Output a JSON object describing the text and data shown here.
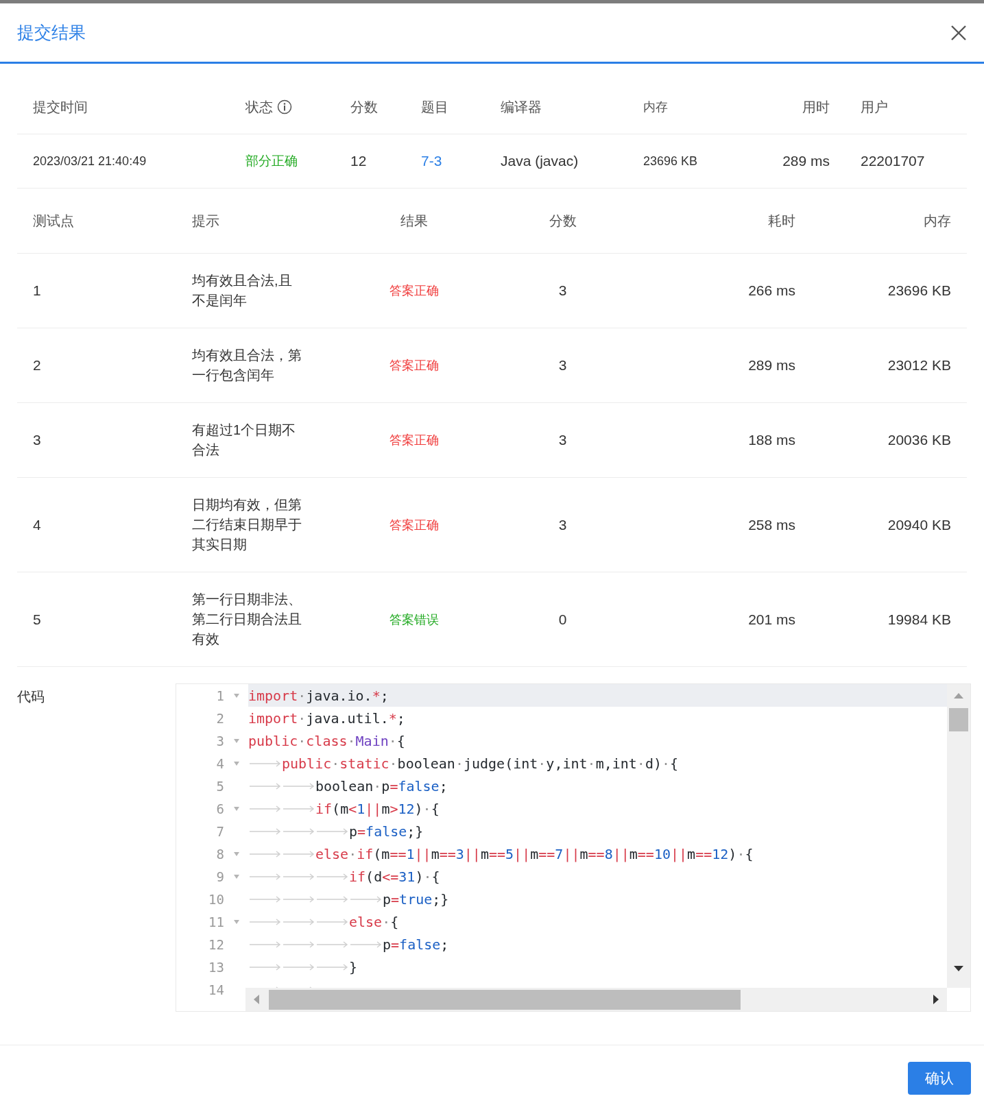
{
  "dialog": {
    "title": "提交结果"
  },
  "submission": {
    "columns": [
      "提交时间",
      "状态",
      "分数",
      "题目",
      "编译器",
      "内存",
      "用时",
      "用户"
    ],
    "row": {
      "time": "2023/03/21 21:40:49",
      "status": {
        "text": "部分正确",
        "color": "#22aa22"
      },
      "score": "12",
      "problem": "7-3",
      "compiler": "Java (javac)",
      "memory": "23696 KB",
      "duration": "289 ms",
      "user": "22201707"
    }
  },
  "results": {
    "columns": [
      "测试点",
      "提示",
      "结果",
      "分数",
      "耗时",
      "内存"
    ],
    "rows": [
      {
        "case": "1",
        "hint": "均有效且合法,且不是闰年",
        "result": "答案正确",
        "color": "#f03c3c",
        "score": "3",
        "time": "266 ms",
        "memory": "23696 KB"
      },
      {
        "case": "2",
        "hint": "均有效且合法，第一行包含闰年",
        "result": "答案正确",
        "color": "#f03c3c",
        "score": "3",
        "time": "289 ms",
        "memory": "23012 KB"
      },
      {
        "case": "3",
        "hint": "有超过1个日期不合法",
        "result": "答案正确",
        "color": "#f03c3c",
        "score": "3",
        "time": "188 ms",
        "memory": "20036 KB"
      },
      {
        "case": "4",
        "hint": "日期均有效，但第二行结束日期早于其实日期",
        "result": "答案正确",
        "color": "#f03c3c",
        "score": "3",
        "time": "258 ms",
        "memory": "20940 KB"
      },
      {
        "case": "5",
        "hint": "第一行日期非法、第二行日期合法且有效",
        "result": "答案错误",
        "color": "#22aa22",
        "score": "0",
        "time": "201 ms",
        "memory": "19984 KB"
      }
    ]
  },
  "code": {
    "label": "代码",
    "lines": [
      {
        "number": "1",
        "fold": true,
        "active": true,
        "tokens": [
          {
            "kind": "kw",
            "t": "import"
          },
          {
            "kind": "ws",
            "t": "·"
          },
          {
            "kind": "pl",
            "t": "java.io."
          },
          {
            "kind": "op",
            "t": "*"
          },
          {
            "kind": "pl",
            "t": ";"
          }
        ]
      },
      {
        "number": "2",
        "fold": false,
        "active": false,
        "tokens": [
          {
            "kind": "kw",
            "t": "import"
          },
          {
            "kind": "ws",
            "t": "·"
          },
          {
            "kind": "pl",
            "t": "java.util."
          },
          {
            "kind": "op",
            "t": "*"
          },
          {
            "kind": "pl",
            "t": ";"
          }
        ]
      },
      {
        "number": "3",
        "fold": true,
        "active": false,
        "tokens": [
          {
            "kind": "kw",
            "t": "public"
          },
          {
            "kind": "ws",
            "t": "·"
          },
          {
            "kind": "kw",
            "t": "class"
          },
          {
            "kind": "ws",
            "t": "·"
          },
          {
            "kind": "ty",
            "t": "Main"
          },
          {
            "kind": "ws",
            "t": "·"
          },
          {
            "kind": "pl",
            "t": "{"
          }
        ],
        "children": [
          {
            "number": "4",
            "fold": true,
            "active": false,
            "tokens": [
              {
                "kind": "kw",
                "t": "public"
              },
              {
                "kind": "ws",
                "t": "·"
              },
              {
                "kind": "kw",
                "t": "static"
              },
              {
                "kind": "ws",
                "t": "·"
              },
              {
                "kind": "pl",
                "t": "boolean"
              },
              {
                "kind": "ws",
                "t": "·"
              },
              {
                "kind": "pl",
                "t": "judge(int"
              },
              {
                "kind": "ws",
                "t": "·"
              },
              {
                "kind": "pl",
                "t": "y,int"
              },
              {
                "kind": "ws",
                "t": "·"
              },
              {
                "kind": "pl",
                "t": "m,int"
              },
              {
                "kind": "ws",
                "t": "·"
              },
              {
                "kind": "pl",
                "t": "d)"
              },
              {
                "kind": "ws",
                "t": "·"
              },
              {
                "kind": "pl",
                "t": "{"
              }
            ],
            "children": [
              {
                "number": "5",
                "fold": false,
                "active": false,
                "tokens": [
                  {
                    "kind": "pl",
                    "t": "boolean"
                  },
                  {
                    "kind": "ws",
                    "t": "·"
                  },
                  {
                    "kind": "pl",
                    "t": "p"
                  },
                  {
                    "kind": "op",
                    "t": "="
                  },
                  {
                    "kind": "nu",
                    "t": "false"
                  },
                  {
                    "kind": "pl",
                    "t": ";"
                  }
                ]
              },
              {
                "number": "6",
                "fold": true,
                "active": false,
                "tokens": [
                  {
                    "kind": "kw",
                    "t": "if"
                  },
                  {
                    "kind": "pl",
                    "t": "(m"
                  },
                  {
                    "kind": "op",
                    "t": "<"
                  },
                  {
                    "kind": "nu",
                    "t": "1"
                  },
                  {
                    "kind": "op",
                    "t": "||"
                  },
                  {
                    "kind": "pl",
                    "t": "m"
                  },
                  {
                    "kind": "op",
                    "t": ">"
                  },
                  {
                    "kind": "nu",
                    "t": "12"
                  },
                  {
                    "kind": "pl",
                    "t": ")"
                  },
                  {
                    "kind": "ws",
                    "t": "·"
                  },
                  {
                    "kind": "pl",
                    "t": "{"
                  }
                ],
                "children": [
                  {
                    "number": "7",
                    "fold": false,
                    "active": false,
                    "tokens": [
                      {
                        "kind": "pl",
                        "t": "p"
                      },
                      {
                        "kind": "op",
                        "t": "="
                      },
                      {
                        "kind": "nu",
                        "t": "false"
                      },
                      {
                        "kind": "pl",
                        "t": ";}"
                      }
                    ]
                  }
                ]
              },
              {
                "number": "8",
                "fold": true,
                "active": false,
                "tokens": [
                  {
                    "kind": "kw",
                    "t": "else"
                  },
                  {
                    "kind": "ws",
                    "t": "·"
                  },
                  {
                    "kind": "kw",
                    "t": "if"
                  },
                  {
                    "kind": "pl",
                    "t": "(m"
                  },
                  {
                    "kind": "op",
                    "t": "=="
                  },
                  {
                    "kind": "nu",
                    "t": "1"
                  },
                  {
                    "kind": "op",
                    "t": "||"
                  },
                  {
                    "kind": "pl",
                    "t": "m"
                  },
                  {
                    "kind": "op",
                    "t": "=="
                  },
                  {
                    "kind": "nu",
                    "t": "3"
                  },
                  {
                    "kind": "op",
                    "t": "||"
                  },
                  {
                    "kind": "pl",
                    "t": "m"
                  },
                  {
                    "kind": "op",
                    "t": "=="
                  },
                  {
                    "kind": "nu",
                    "t": "5"
                  },
                  {
                    "kind": "op",
                    "t": "||"
                  },
                  {
                    "kind": "pl",
                    "t": "m"
                  },
                  {
                    "kind": "op",
                    "t": "=="
                  },
                  {
                    "kind": "nu",
                    "t": "7"
                  },
                  {
                    "kind": "op",
                    "t": "||"
                  },
                  {
                    "kind": "pl",
                    "t": "m"
                  },
                  {
                    "kind": "op",
                    "t": "=="
                  },
                  {
                    "kind": "nu",
                    "t": "8"
                  },
                  {
                    "kind": "op",
                    "t": "||"
                  },
                  {
                    "kind": "pl",
                    "t": "m"
                  },
                  {
                    "kind": "op",
                    "t": "=="
                  },
                  {
                    "kind": "nu",
                    "t": "10"
                  },
                  {
                    "kind": "op",
                    "t": "||"
                  },
                  {
                    "kind": "pl",
                    "t": "m"
                  },
                  {
                    "kind": "op",
                    "t": "=="
                  },
                  {
                    "kind": "nu",
                    "t": "12"
                  },
                  {
                    "kind": "pl",
                    "t": ")"
                  },
                  {
                    "kind": "ws",
                    "t": "·"
                  },
                  {
                    "kind": "pl",
                    "t": "{"
                  }
                ],
                "children": [
                  {
                    "number": "9",
                    "fold": true,
                    "active": false,
                    "tokens": [
                      {
                        "kind": "kw",
                        "t": "if"
                      },
                      {
                        "kind": "pl",
                        "t": "(d"
                      },
                      {
                        "kind": "op",
                        "t": "<="
                      },
                      {
                        "kind": "nu",
                        "t": "31"
                      },
                      {
                        "kind": "pl",
                        "t": ")"
                      },
                      {
                        "kind": "ws",
                        "t": "·"
                      },
                      {
                        "kind": "pl",
                        "t": "{"
                      }
                    ],
                    "children": [
                      {
                        "number": "10",
                        "fold": false,
                        "active": false,
                        "tokens": [
                          {
                            "kind": "pl",
                            "t": "p"
                          },
                          {
                            "kind": "op",
                            "t": "="
                          },
                          {
                            "kind": "nu",
                            "t": "true"
                          },
                          {
                            "kind": "pl",
                            "t": ";}"
                          }
                        ]
                      }
                    ]
                  },
                  {
                    "number": "11",
                    "fold": true,
                    "active": false,
                    "tokens": [
                      {
                        "kind": "kw",
                        "t": "else"
                      },
                      {
                        "kind": "ws",
                        "t": "·"
                      },
                      {
                        "kind": "pl",
                        "t": "{"
                      }
                    ],
                    "children": [
                      {
                        "number": "12",
                        "fold": false,
                        "active": false,
                        "tokens": [
                          {
                            "kind": "pl",
                            "t": "p"
                          },
                          {
                            "kind": "op",
                            "t": "="
                          },
                          {
                            "kind": "nu",
                            "t": "false"
                          },
                          {
                            "kind": "pl",
                            "t": ";"
                          }
                        ]
                      }
                    ]
                  },
                  {
                    "number": "13",
                    "fold": false,
                    "active": false,
                    "tokens": [
                      {
                        "kind": "pl",
                        "t": "}"
                      }
                    ]
                  }
                ]
              },
              {
                "number": "14",
                "fold": false,
                "active": false
              }
            ]
          }
        ]
      }
    ]
  },
  "footer": {
    "confirm": "确认"
  }
}
